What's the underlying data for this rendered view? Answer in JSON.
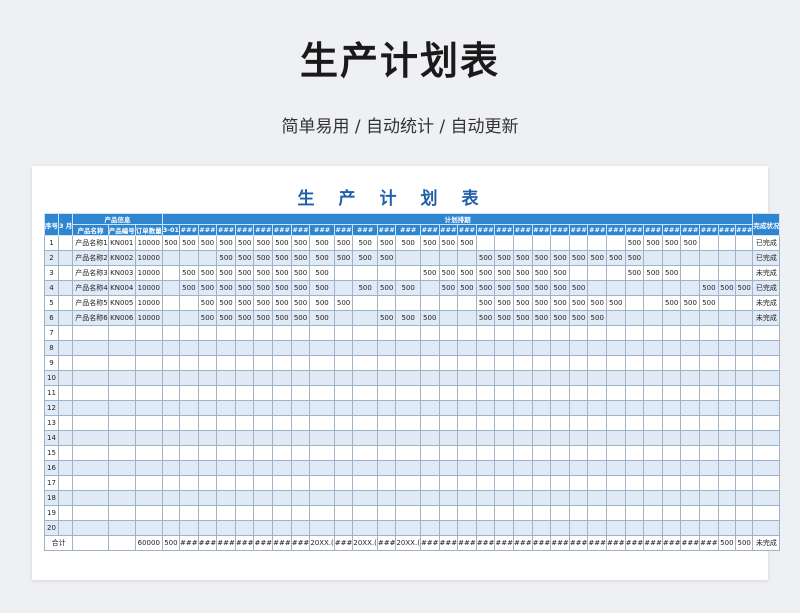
{
  "page": {
    "title": "生产计划表",
    "subtitle": "简单易用  /  自动统计  /  自动更新"
  },
  "sheet": {
    "title": "生产计划表",
    "headers": {
      "seq": "序号",
      "month": "3 月",
      "product_info": "产品信息",
      "product_name": "产品名称",
      "product_code": "产品编号",
      "order_qty": "订单数量",
      "plan": "计划排期",
      "status": "完成状况",
      "first_day": "3-01"
    },
    "date_placeholder": "###",
    "rows": [
      {
        "seq": "1",
        "name": "产品名称1",
        "code": "KN001",
        "qty": "10000",
        "status": "已完成",
        "cells": [
          "500",
          "500",
          "500",
          "500",
          "500",
          "500",
          "500",
          "500",
          "500",
          "500",
          "500",
          "500",
          "500",
          "500",
          "500",
          "500",
          "",
          "",
          "",
          "",
          "",
          "",
          "",
          "",
          "500",
          "500",
          "500",
          "500",
          "",
          "",
          ""
        ]
      },
      {
        "seq": "2",
        "name": "产品名称2",
        "code": "KN002",
        "qty": "10000",
        "status": "已完成",
        "cells": [
          "",
          "",
          "",
          "500",
          "500",
          "500",
          "500",
          "500",
          "500",
          "500",
          "500",
          "500",
          "",
          "",
          "",
          "",
          "500",
          "500",
          "500",
          "500",
          "500",
          "500",
          "500",
          "500",
          "500",
          "",
          "",
          "",
          "",
          "",
          ""
        ]
      },
      {
        "seq": "3",
        "name": "产品名称3",
        "code": "KN003",
        "qty": "10000",
        "status": "未完成",
        "cells": [
          "",
          "500",
          "500",
          "500",
          "500",
          "500",
          "500",
          "500",
          "500",
          "",
          "",
          "",
          "",
          "500",
          "500",
          "500",
          "500",
          "500",
          "500",
          "500",
          "500",
          "",
          "",
          "",
          "500",
          "500",
          "500",
          "",
          "",
          "",
          ""
        ]
      },
      {
        "seq": "4",
        "name": "产品名称4",
        "code": "KN004",
        "qty": "10000",
        "status": "已完成",
        "cells": [
          "",
          "500",
          "500",
          "500",
          "500",
          "500",
          "500",
          "500",
          "500",
          "",
          "500",
          "500",
          "500",
          "",
          "500",
          "500",
          "500",
          "500",
          "500",
          "500",
          "500",
          "500",
          "",
          "",
          "",
          "",
          "",
          "",
          "500",
          "500",
          "500"
        ]
      },
      {
        "seq": "5",
        "name": "产品名称5",
        "code": "KN005",
        "qty": "10000",
        "status": "未完成",
        "cells": [
          "",
          "",
          "500",
          "500",
          "500",
          "500",
          "500",
          "500",
          "500",
          "500",
          "",
          "",
          "",
          "",
          "",
          "",
          "500",
          "500",
          "500",
          "500",
          "500",
          "500",
          "500",
          "500",
          "",
          "",
          "500",
          "500",
          "500",
          "",
          ""
        ]
      },
      {
        "seq": "6",
        "name": "产品名称6",
        "code": "KN006",
        "qty": "10000",
        "status": "未完成",
        "cells": [
          "",
          "",
          "500",
          "500",
          "500",
          "500",
          "500",
          "500",
          "500",
          "",
          "",
          "500",
          "500",
          "500",
          "",
          "",
          "500",
          "500",
          "500",
          "500",
          "500",
          "500",
          "500",
          "",
          "",
          "",
          "",
          "",
          "",
          "",
          ""
        ]
      }
    ],
    "empty_rows": [
      "7",
      "8",
      "9",
      "10",
      "11",
      "12",
      "13",
      "14",
      "15",
      "16",
      "17",
      "18",
      "19",
      "20"
    ],
    "total": {
      "label": "合计",
      "qty": "60000",
      "status": "未完成",
      "cells": [
        "500",
        "###",
        "###",
        "###",
        "###",
        "###",
        "###",
        "###",
        "20XX.(",
        "###",
        "20XX.(",
        "###",
        "20XX.(",
        "###",
        "###",
        "###",
        "###",
        "###",
        "###",
        "###",
        "###",
        "###",
        "###",
        "###",
        "###",
        "###",
        "###",
        "###",
        "###",
        "500",
        "500"
      ]
    }
  }
}
